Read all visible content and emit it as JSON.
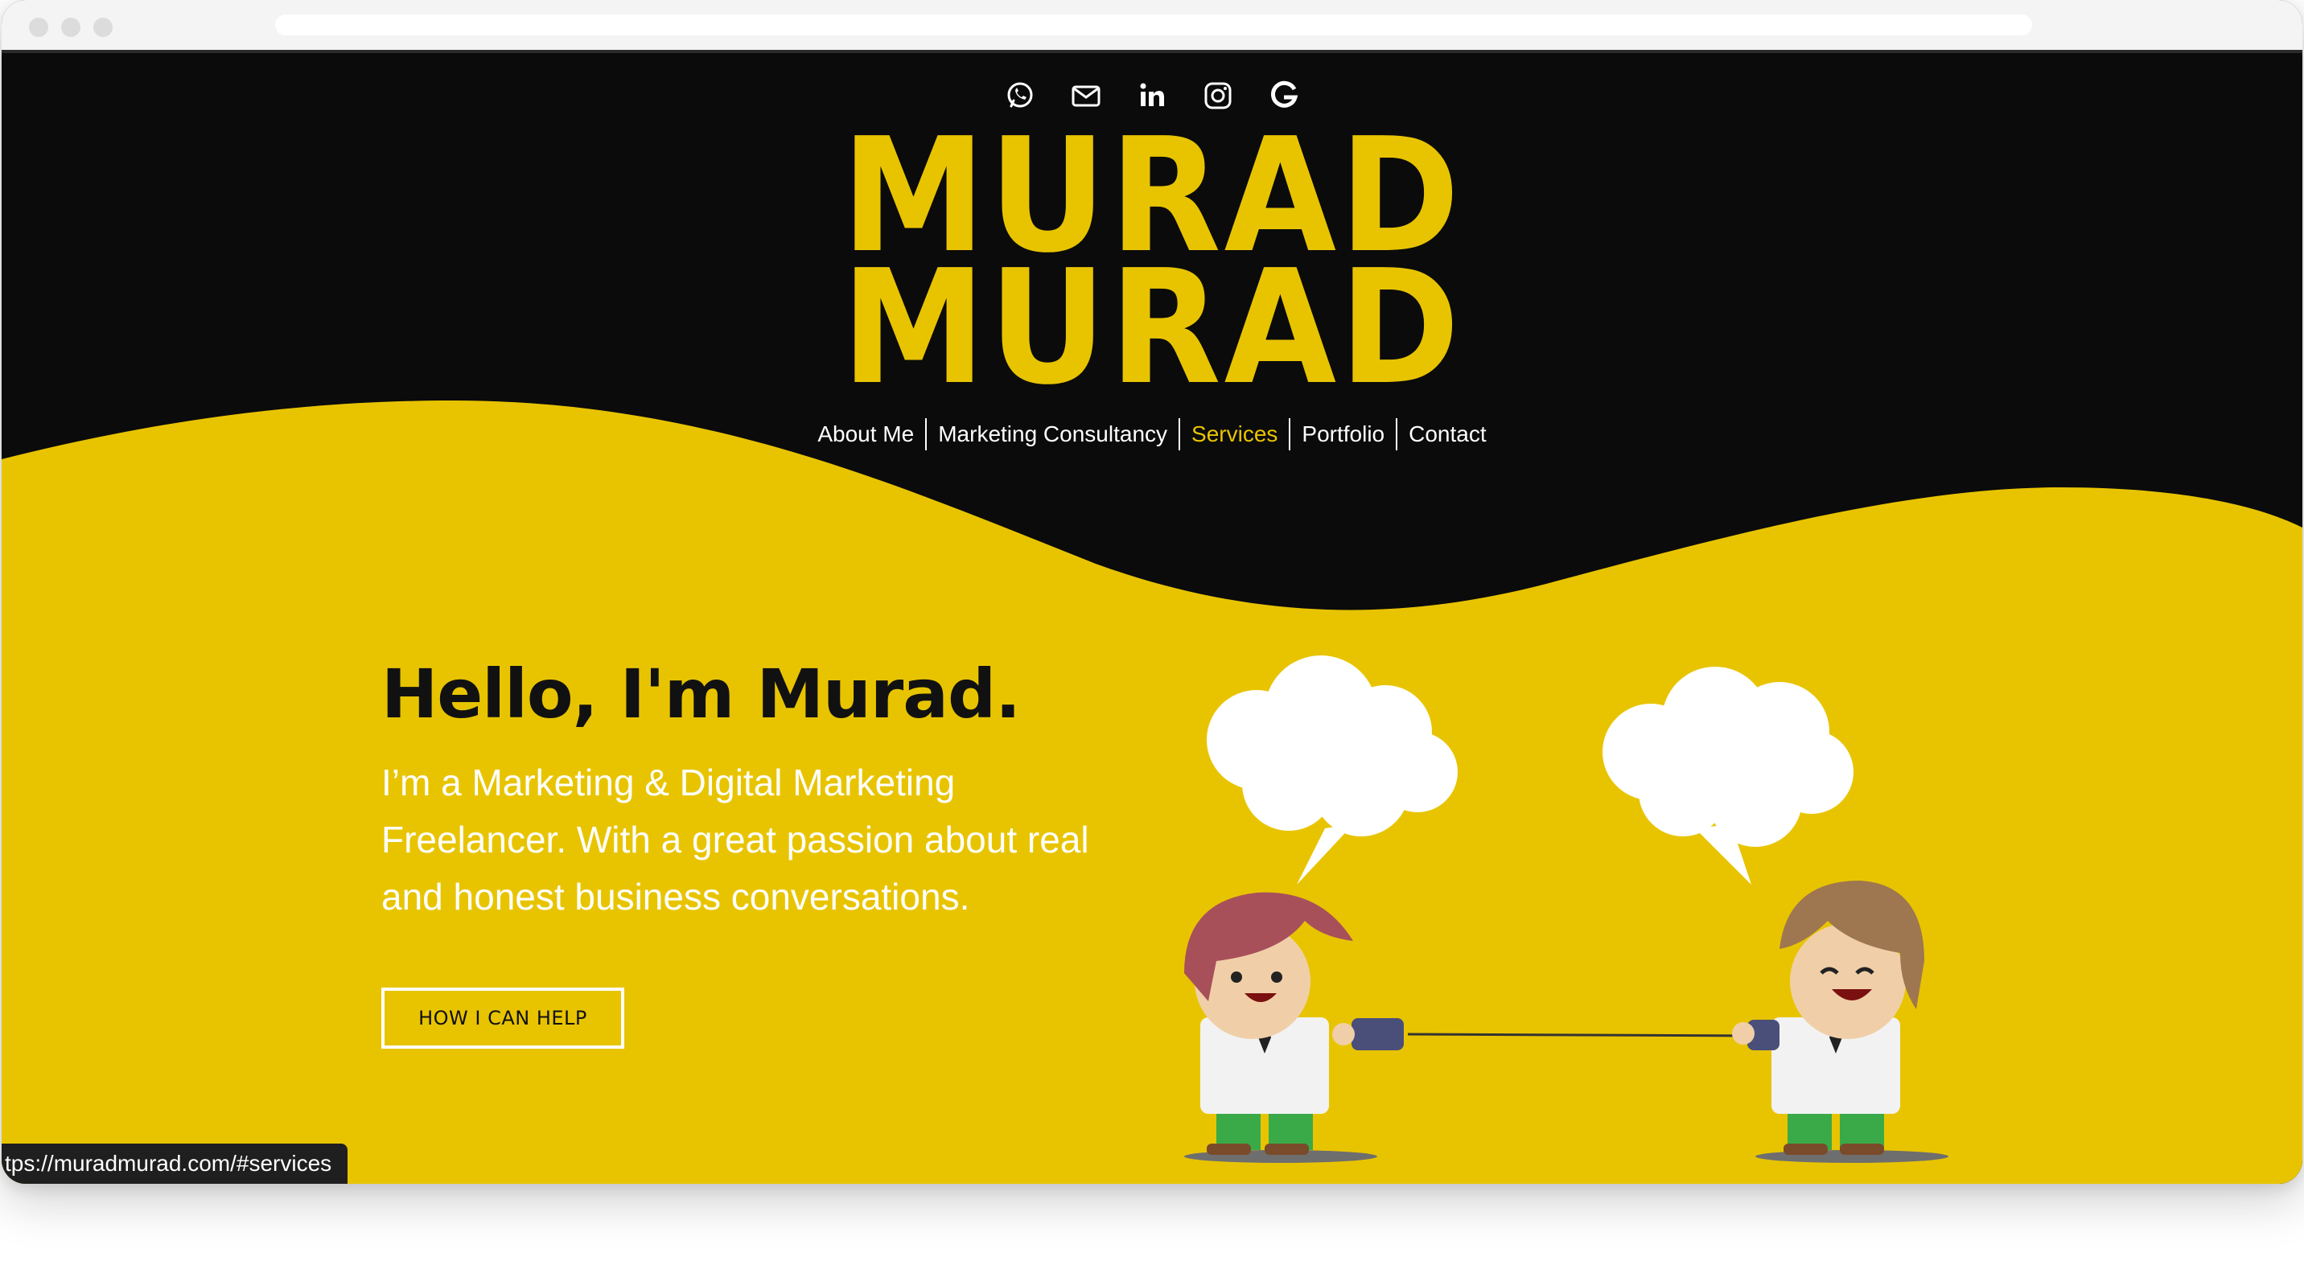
{
  "colors": {
    "brand_yellow": "#e8c400",
    "background_black": "#0b0b0b",
    "text_white": "#ffffff"
  },
  "social_icons": [
    {
      "icon": "whatsapp-icon"
    },
    {
      "icon": "mail-icon"
    },
    {
      "icon": "linkedin-icon"
    },
    {
      "icon": "instagram-icon"
    },
    {
      "icon": "google-icon"
    }
  ],
  "logo": {
    "line1": "MURAD",
    "line2": "MURAD"
  },
  "nav": {
    "items": [
      {
        "label": "About Me"
      },
      {
        "label": "Marketing Consultancy"
      },
      {
        "label": "Services",
        "active": true
      },
      {
        "label": "Portfolio"
      },
      {
        "label": "Contact"
      }
    ]
  },
  "hero": {
    "title": "Hello, I'm Murad.",
    "text": "I’m a Marketing & Digital Marketing Freelancer. With a great passion about real and honest business conversations.",
    "cta_label": "HOW I CAN HELP"
  },
  "status_url": "tps://muradmurad.com/#services"
}
